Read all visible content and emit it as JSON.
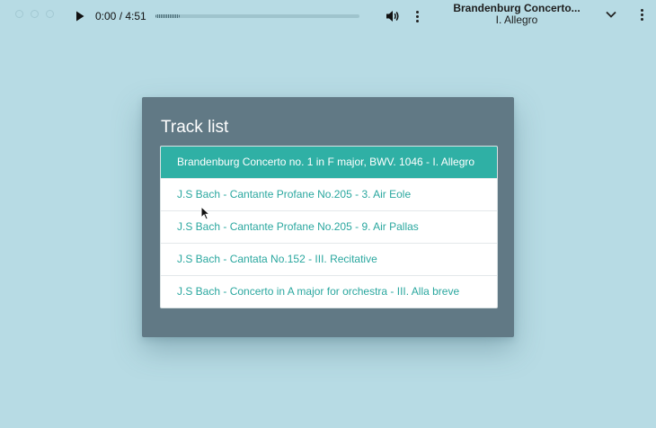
{
  "player": {
    "time": "0:00 / 4:51",
    "progress_fraction": 0.0,
    "buffered_fraction": 0.12,
    "icons": {
      "play": "play-icon",
      "volume": "volume-icon",
      "menu": "more-vertical-icon"
    }
  },
  "now_playing": {
    "title": "Brandenburg Concerto...",
    "movement": "I. Allegro",
    "chevron_icon": "chevron-down-icon",
    "menu_icon": "more-vertical-icon"
  },
  "tracklist": {
    "heading": "Track list",
    "active_index": 0,
    "tracks": [
      "Brandenburg Concerto no. 1 in F major, BWV. 1046 - I. Allegro",
      "J.S Bach - Cantante Profane No.205 - 3. Air Eole",
      "J.S Bach - Cantante Profane No.205 - 9. Air Pallas",
      "J.S Bach - Cantata No.152 - III. Recitative",
      "J.S Bach - Concerto in A major for orchestra - III. Alla breve"
    ]
  },
  "colors": {
    "background": "#b7dbe4",
    "panel": "#617985",
    "accent": "#2fb0a5",
    "track_text": "#2aa79f"
  }
}
